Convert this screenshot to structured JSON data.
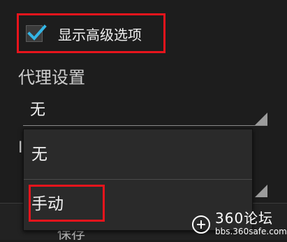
{
  "advanced_options": {
    "checked": true,
    "label": "显示高级选项"
  },
  "proxy_settings": {
    "title": "代理设置",
    "selected_value": "无",
    "options": [
      "无",
      "手动"
    ]
  },
  "hidden_field": {
    "partial_label": "I"
  },
  "footer": {
    "save_label": "保存"
  },
  "watermark": {
    "title": "360论坛",
    "url": "bbs.360safe.com"
  },
  "colors": {
    "highlight": "#e8141c",
    "checkbox_check": "#33b5e5"
  }
}
